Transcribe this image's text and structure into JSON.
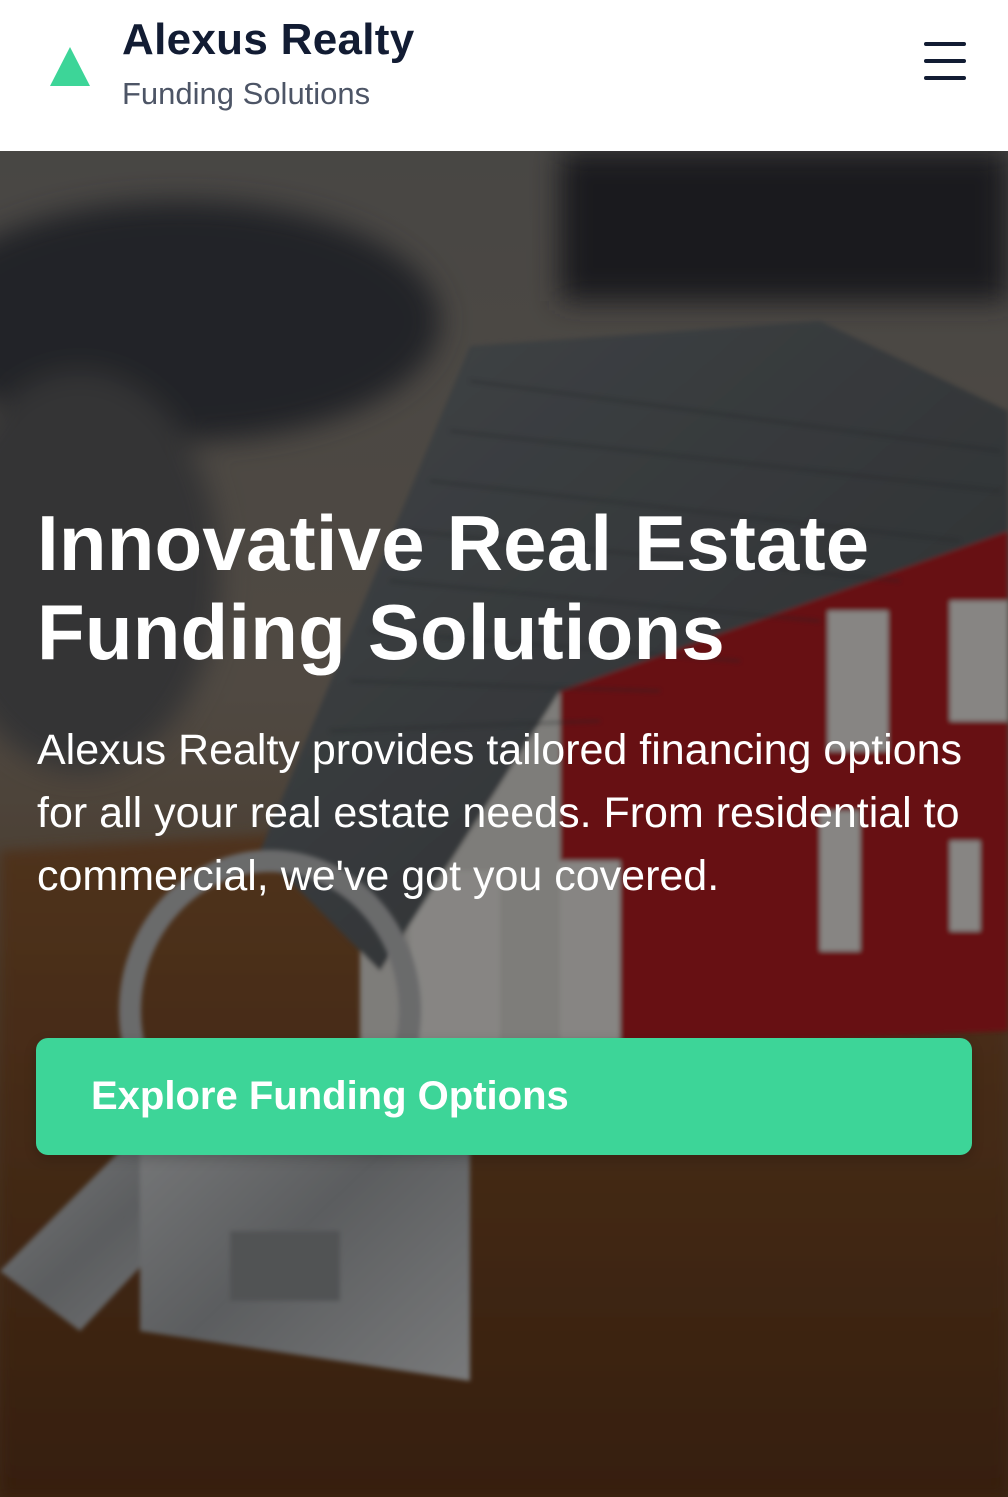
{
  "header": {
    "brand_name": "Alexus Realty",
    "brand_tagline": "Funding Solutions",
    "logo_icon": "triangle-logo-icon",
    "menu_icon": "hamburger-menu-icon"
  },
  "hero": {
    "title_line1": "Innovative Real Estate",
    "title_line2": "Funding Solutions",
    "description": "Alexus Realty provides tailored financing options for all your real estate needs. From residential to commercial, we've got you covered.",
    "cta_label": "Explore Funding Options",
    "background_image": "model-house-with-keys-photo"
  },
  "colors": {
    "accent": "#3dd598",
    "brand_text": "#121c33",
    "tagline_text": "#4d5566",
    "hero_text": "#ffffff"
  }
}
